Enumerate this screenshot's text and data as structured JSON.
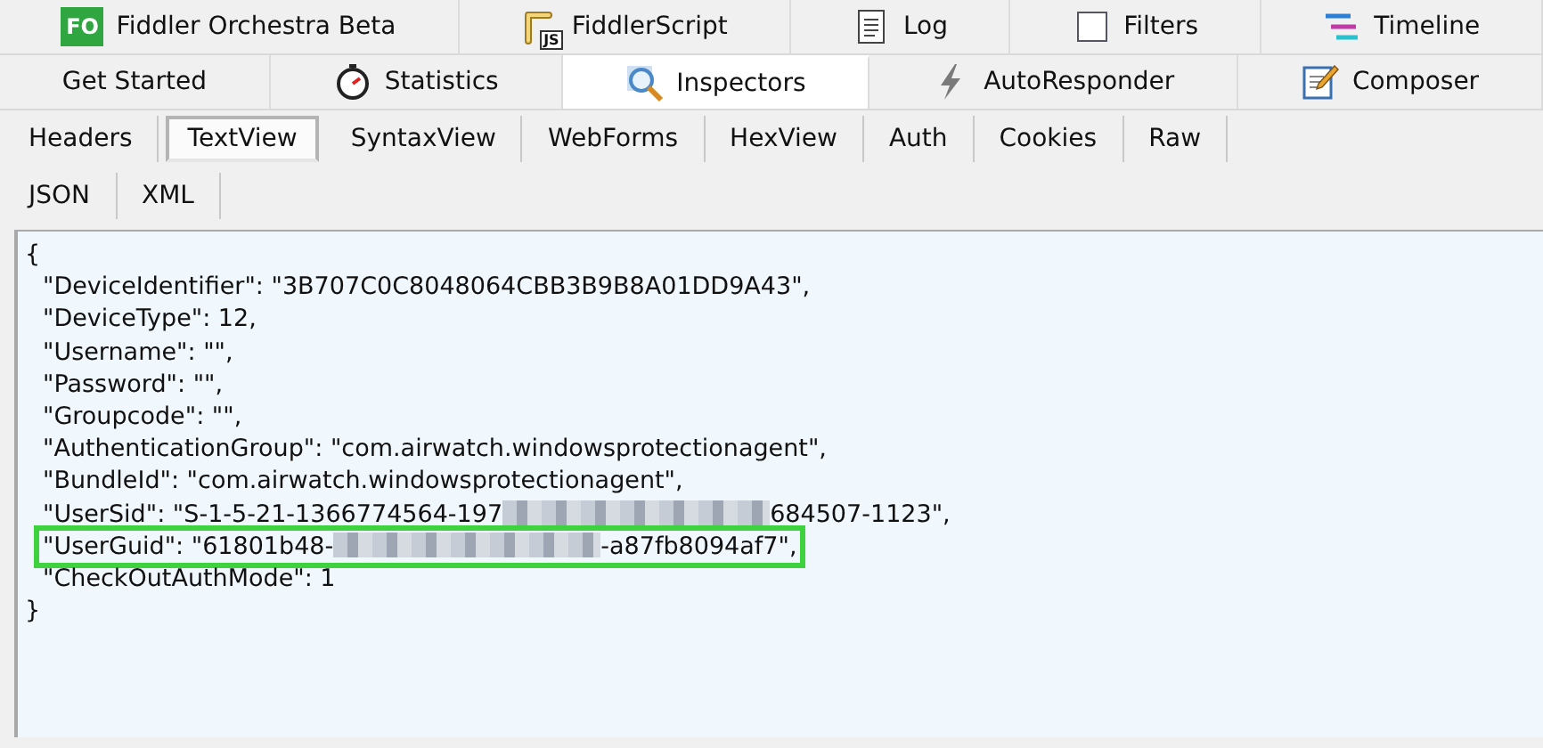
{
  "main_tabs": [
    [
      {
        "label": "Fiddler Orchestra Beta",
        "icon_text": "FO",
        "selected": false
      },
      {
        "label": "FiddlerScript",
        "icon_text": "JS",
        "selected": false
      },
      {
        "label": "Log",
        "selected": false
      },
      {
        "label": "Filters",
        "selected": false
      },
      {
        "label": "Timeline",
        "selected": false
      }
    ],
    [
      {
        "label": "Get Started",
        "selected": false
      },
      {
        "label": "Statistics",
        "selected": false
      },
      {
        "label": "Inspectors",
        "selected": true
      },
      {
        "label": "AutoResponder",
        "selected": false
      },
      {
        "label": "Composer",
        "selected": false
      }
    ]
  ],
  "inspector_tabs": [
    [
      {
        "label": "Headers",
        "selected": false
      },
      {
        "label": "TextView",
        "selected": true
      },
      {
        "label": "SyntaxView",
        "selected": false
      },
      {
        "label": "WebForms",
        "selected": false
      },
      {
        "label": "HexView",
        "selected": false
      },
      {
        "label": "Auth",
        "selected": false
      },
      {
        "label": "Cookies",
        "selected": false
      },
      {
        "label": "Raw",
        "selected": false
      }
    ],
    [
      {
        "label": "JSON",
        "selected": false
      },
      {
        "label": "XML",
        "selected": false
      }
    ]
  ],
  "text_view": {
    "lines": [
      {
        "highlighted": false,
        "parts": [
          {
            "kind": "text",
            "text": "{"
          }
        ]
      },
      {
        "highlighted": false,
        "parts": [
          {
            "kind": "text",
            "text": "\"DeviceIdentifier\": \"3B707C0C8048064CBB3B9B8A01DD9A43\","
          }
        ]
      },
      {
        "highlighted": false,
        "parts": [
          {
            "kind": "text",
            "text": "\"DeviceType\": 12,"
          }
        ]
      },
      {
        "highlighted": false,
        "parts": [
          {
            "kind": "text",
            "text": "\"Username\": \"\","
          }
        ]
      },
      {
        "highlighted": false,
        "parts": [
          {
            "kind": "text",
            "text": "\"Password\": \"\","
          }
        ]
      },
      {
        "highlighted": false,
        "parts": [
          {
            "kind": "text",
            "text": "\"Groupcode\": \"\","
          }
        ]
      },
      {
        "highlighted": false,
        "parts": [
          {
            "kind": "text",
            "text": "\"AuthenticationGroup\": \"com.airwatch.windowsprotectionagent\","
          }
        ]
      },
      {
        "highlighted": false,
        "parts": [
          {
            "kind": "text",
            "text": "\"BundleId\": \"com.airwatch.windowsprotectionagent\","
          }
        ]
      },
      {
        "highlighted": false,
        "parts": [
          {
            "kind": "text",
            "text": "\"UserSid\": \"S-1-5-21-1366774564-197"
          },
          {
            "kind": "redacted"
          },
          {
            "kind": "text",
            "text": "684507-1123\","
          }
        ]
      },
      {
        "highlighted": true,
        "parts": [
          {
            "kind": "text",
            "text": "\"UserGuid\": \"61801b48-"
          },
          {
            "kind": "redacted"
          },
          {
            "kind": "text",
            "text": "-a87fb8094af7\","
          }
        ]
      },
      {
        "highlighted": false,
        "parts": [
          {
            "kind": "text",
            "text": "\"CheckOutAuthMode\": 1"
          }
        ]
      },
      {
        "highlighted": false,
        "parts": [
          {
            "kind": "text",
            "text": "}"
          }
        ]
      }
    ]
  }
}
